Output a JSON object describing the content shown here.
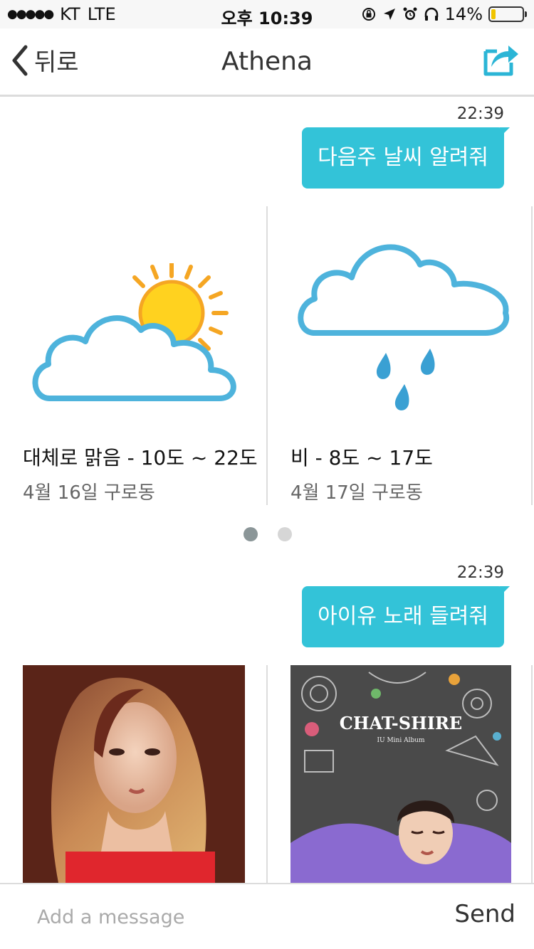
{
  "status_bar": {
    "carrier": "KT",
    "network": "LTE",
    "time": "오후 10:39",
    "battery_percent": "14%",
    "battery_level": 0.14
  },
  "nav": {
    "back_label": "뒤로",
    "title": "Athena"
  },
  "messages": [
    {
      "time": "22:39",
      "text": "다음주 날씨 알려줘"
    },
    {
      "time": "22:39",
      "text": "아이유 노래 들려줘"
    }
  ],
  "weather_cards": [
    {
      "icon": "partly-cloudy-icon",
      "title": "대체로 맑음 - 10도 ~ 22도",
      "subtitle": "4월 16일 구로동"
    },
    {
      "icon": "rain-icon",
      "title": "비 - 8도 ~ 17도",
      "subtitle": "4월 17일 구로동"
    }
  ],
  "pager": {
    "pages": 2,
    "active": 1
  },
  "music_cards": [
    {
      "image": "artist-photo"
    },
    {
      "image": "album-cover",
      "cover_title": "CHAT-SHIRE",
      "cover_subtitle": "IU Mini Album"
    }
  ],
  "input": {
    "placeholder": "Add a message",
    "send_label": "Send"
  },
  "colors": {
    "accent": "#33c3d8",
    "share_icon": "#2bb5d6",
    "battery": "#f0c400"
  }
}
